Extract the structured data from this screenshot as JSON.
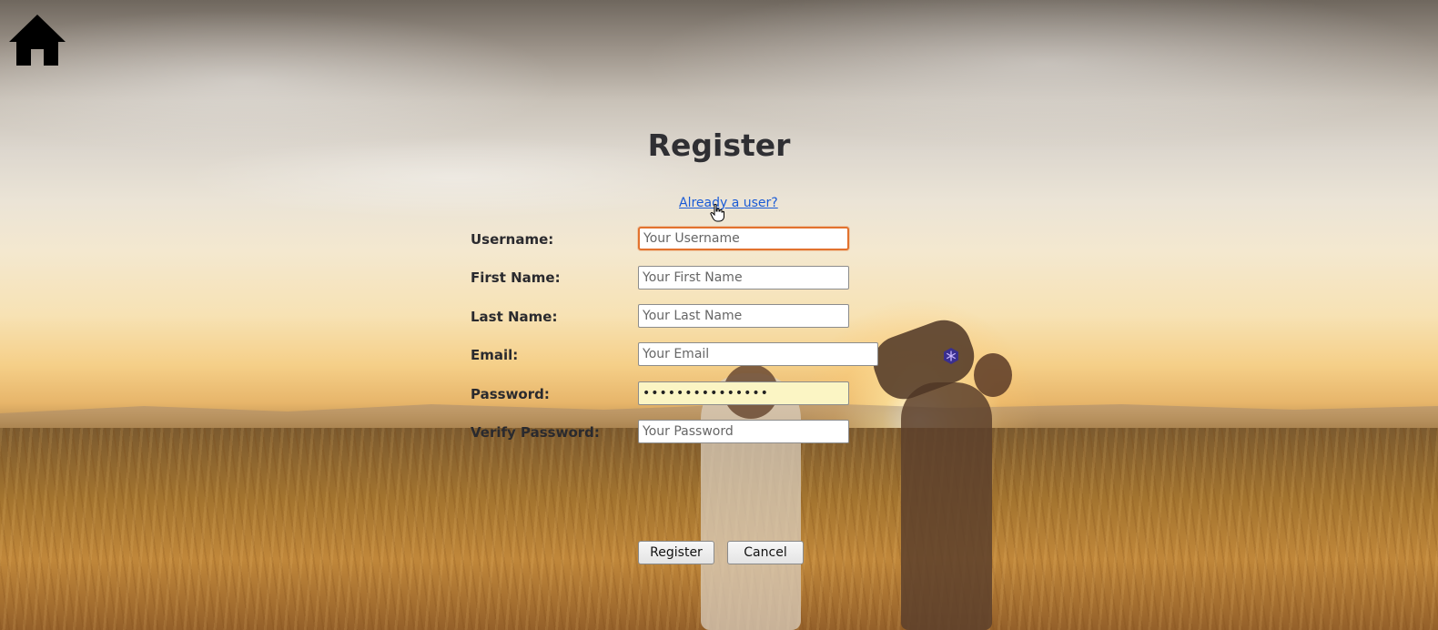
{
  "page": {
    "title": "Register",
    "already_user_link": "Already a user?"
  },
  "form": {
    "fields": [
      {
        "label": "Username:",
        "placeholder": "Your Username",
        "value": ""
      },
      {
        "label": "First Name:",
        "placeholder": "Your First Name",
        "value": ""
      },
      {
        "label": "Last Name:",
        "placeholder": "Your Last Name",
        "value": ""
      },
      {
        "label": "Email:",
        "placeholder": "Your Email",
        "value": ""
      },
      {
        "label": "Password:",
        "placeholder": "",
        "value": "•••••••••••••••"
      },
      {
        "label": "Verify Password:",
        "placeholder": "Your Password",
        "value": ""
      }
    ],
    "register_label": "Register",
    "cancel_label": "Cancel"
  },
  "icons": {
    "home": "home-icon",
    "cursor": "hand-pointer-icon",
    "extension": "password-manager-icon"
  },
  "colors": {
    "link": "#1a5bd6",
    "focus_border": "#e2722e",
    "autofill_bg": "#fbf5c4",
    "title": "#2f2f33"
  }
}
